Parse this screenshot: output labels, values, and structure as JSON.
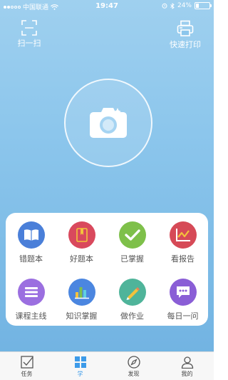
{
  "status_bar": {
    "carrier": "中国联通",
    "time": "19:47",
    "battery": "24%",
    "battery_level": 0.24
  },
  "top": {
    "scan_label": "扫一扫",
    "print_label": "快速打印"
  },
  "features": [
    {
      "label": "错题本",
      "icon": "book-icon",
      "color": "#4a7fd9"
    },
    {
      "label": "好题本",
      "icon": "bookmark-book-icon",
      "color": "#d9495d"
    },
    {
      "label": "已掌握",
      "icon": "check-icon",
      "color": "#7ec04a"
    },
    {
      "label": "看报告",
      "icon": "chart-report-icon",
      "color": "#d64a57"
    },
    {
      "label": "课程主线",
      "icon": "list-icon",
      "color": "#9b6fe0"
    },
    {
      "label": "知识掌握",
      "icon": "bar-chart-icon",
      "color": "#4b86e0"
    },
    {
      "label": "做作业",
      "icon": "pencil-icon",
      "color": "#4fb49a"
    },
    {
      "label": "每日一问",
      "icon": "chat-icon",
      "color": "#8a5ed6"
    }
  ],
  "tabs": [
    {
      "label": "任务",
      "icon": "task-icon",
      "active": false
    },
    {
      "label": "学",
      "icon": "grid-icon",
      "active": true
    },
    {
      "label": "发现",
      "icon": "compass-icon",
      "active": false
    },
    {
      "label": "我的",
      "icon": "user-icon",
      "active": false
    }
  ],
  "colors": {
    "accent": "#3d9be9",
    "background_top": "#9fd0ef",
    "background_bottom": "#6fb1e1"
  }
}
